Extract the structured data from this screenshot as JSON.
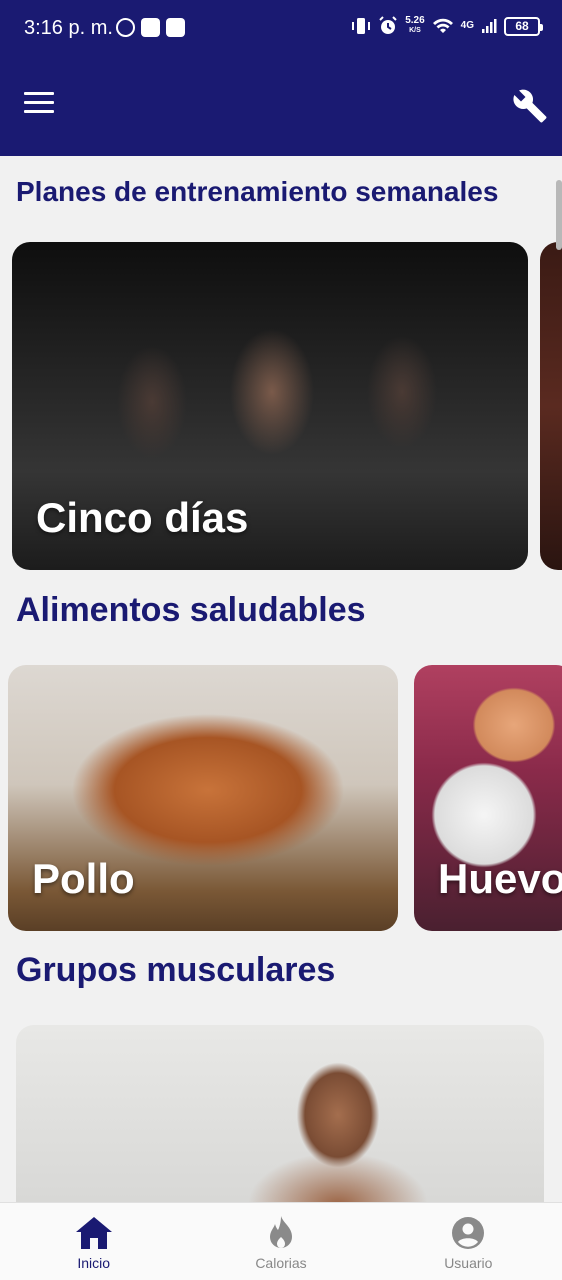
{
  "status_bar": {
    "time": "3:16 p. m.",
    "speed_value": "5.26",
    "speed_unit": "K/S",
    "network": "4G",
    "battery": "68"
  },
  "app_bar": {
    "background_color": "#1a1a72",
    "menu_icon": "hamburger-menu-icon",
    "settings_icon": "wrench-icon"
  },
  "sections": {
    "plans": {
      "title": "Planes de entrenamiento semanales",
      "cards": [
        {
          "label": "Cinco días"
        }
      ]
    },
    "foods": {
      "title": "Alimentos saludables",
      "cards": [
        {
          "label": "Pollo"
        },
        {
          "label": "Huevo"
        }
      ]
    },
    "muscles": {
      "title": "Grupos musculares"
    }
  },
  "bottom_nav": {
    "active_color": "#1a1a72",
    "inactive_color": "#888888",
    "items": [
      {
        "label": "Inicio",
        "icon": "home-icon",
        "active": true
      },
      {
        "label": "Calorias",
        "icon": "flame-icon",
        "active": false
      },
      {
        "label": "Usuario",
        "icon": "user-circle-icon",
        "active": false
      }
    ]
  }
}
